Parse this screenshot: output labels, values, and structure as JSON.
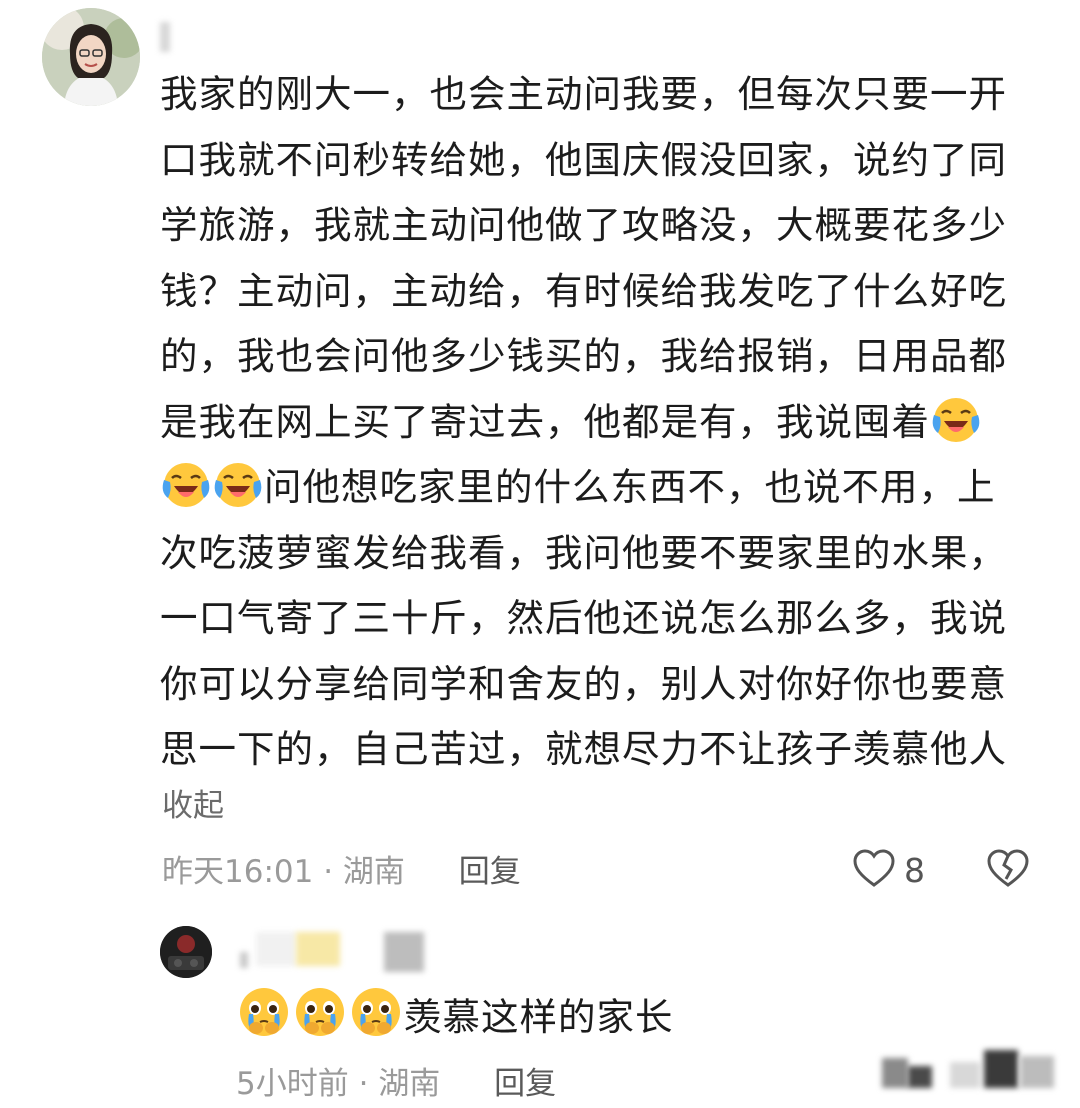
{
  "comment": {
    "lines": [
      "我家的刚大一，也会主动问我要，但每次只要一开",
      "口我就不问秒转给她，他国庆假没回家，说约了同",
      "学旅游，我就主动问他做了攻略没，大概要花多少",
      "钱？主动问，主动给，有时候给我发吃了什么好吃",
      "的，我也会问他多少钱买的，我给报销，日用品都",
      "是我在网上买了寄过去，他都是有，我说囤着",
      "问他想吃家里的什么东西不，也说不用，上",
      "次吃菠萝蜜发给我看，我问他要不要家里的水果，",
      "一口气寄了三十斤，然后他还说怎么那么多，我说",
      "你可以分享给同学和舍友的，别人对你好你也要意",
      "思一下的，自己苦过，就想尽力不让孩子羡慕他人"
    ],
    "collapse_label": "收起",
    "time": "昨天16:01",
    "location": "湖南",
    "separator": "·",
    "reply_label": "回复",
    "like_count": "8",
    "icons": {
      "like": "heart-icon",
      "dislike": "broken-heart-icon",
      "emoji": "laughing-crying-emoji"
    }
  },
  "reply": {
    "text": "羡慕这样的家长",
    "time": "5小时前",
    "location": "湖南",
    "separator": "·",
    "reply_label": "回复",
    "icons": {
      "emoji": "pleading-crying-emoji"
    }
  },
  "colors": {
    "meta": "#9a9a9a",
    "text": "#1c1c1c",
    "emoji_face": "#ffc83d"
  }
}
